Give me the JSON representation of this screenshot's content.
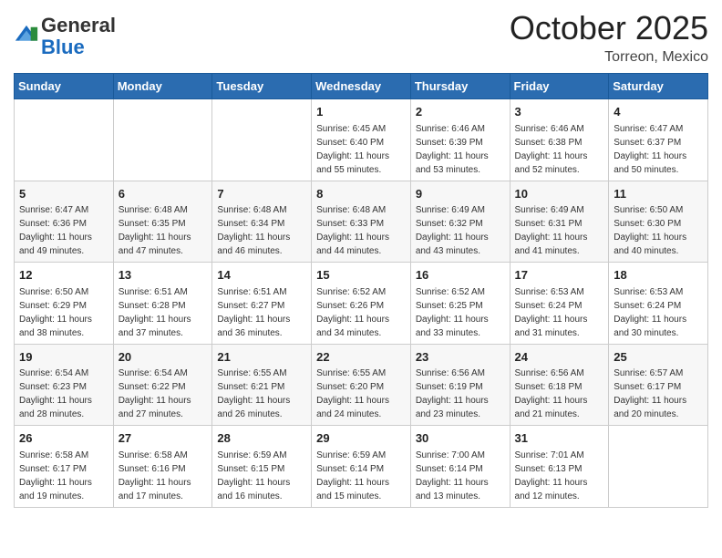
{
  "header": {
    "logo_general": "General",
    "logo_blue": "Blue",
    "month_title": "October 2025",
    "location": "Torreon, Mexico"
  },
  "days_of_week": [
    "Sunday",
    "Monday",
    "Tuesday",
    "Wednesday",
    "Thursday",
    "Friday",
    "Saturday"
  ],
  "weeks": [
    [
      {
        "day": "",
        "info": ""
      },
      {
        "day": "",
        "info": ""
      },
      {
        "day": "",
        "info": ""
      },
      {
        "day": "1",
        "info": "Sunrise: 6:45 AM\nSunset: 6:40 PM\nDaylight: 11 hours\nand 55 minutes."
      },
      {
        "day": "2",
        "info": "Sunrise: 6:46 AM\nSunset: 6:39 PM\nDaylight: 11 hours\nand 53 minutes."
      },
      {
        "day": "3",
        "info": "Sunrise: 6:46 AM\nSunset: 6:38 PM\nDaylight: 11 hours\nand 52 minutes."
      },
      {
        "day": "4",
        "info": "Sunrise: 6:47 AM\nSunset: 6:37 PM\nDaylight: 11 hours\nand 50 minutes."
      }
    ],
    [
      {
        "day": "5",
        "info": "Sunrise: 6:47 AM\nSunset: 6:36 PM\nDaylight: 11 hours\nand 49 minutes."
      },
      {
        "day": "6",
        "info": "Sunrise: 6:48 AM\nSunset: 6:35 PM\nDaylight: 11 hours\nand 47 minutes."
      },
      {
        "day": "7",
        "info": "Sunrise: 6:48 AM\nSunset: 6:34 PM\nDaylight: 11 hours\nand 46 minutes."
      },
      {
        "day": "8",
        "info": "Sunrise: 6:48 AM\nSunset: 6:33 PM\nDaylight: 11 hours\nand 44 minutes."
      },
      {
        "day": "9",
        "info": "Sunrise: 6:49 AM\nSunset: 6:32 PM\nDaylight: 11 hours\nand 43 minutes."
      },
      {
        "day": "10",
        "info": "Sunrise: 6:49 AM\nSunset: 6:31 PM\nDaylight: 11 hours\nand 41 minutes."
      },
      {
        "day": "11",
        "info": "Sunrise: 6:50 AM\nSunset: 6:30 PM\nDaylight: 11 hours\nand 40 minutes."
      }
    ],
    [
      {
        "day": "12",
        "info": "Sunrise: 6:50 AM\nSunset: 6:29 PM\nDaylight: 11 hours\nand 38 minutes."
      },
      {
        "day": "13",
        "info": "Sunrise: 6:51 AM\nSunset: 6:28 PM\nDaylight: 11 hours\nand 37 minutes."
      },
      {
        "day": "14",
        "info": "Sunrise: 6:51 AM\nSunset: 6:27 PM\nDaylight: 11 hours\nand 36 minutes."
      },
      {
        "day": "15",
        "info": "Sunrise: 6:52 AM\nSunset: 6:26 PM\nDaylight: 11 hours\nand 34 minutes."
      },
      {
        "day": "16",
        "info": "Sunrise: 6:52 AM\nSunset: 6:25 PM\nDaylight: 11 hours\nand 33 minutes."
      },
      {
        "day": "17",
        "info": "Sunrise: 6:53 AM\nSunset: 6:24 PM\nDaylight: 11 hours\nand 31 minutes."
      },
      {
        "day": "18",
        "info": "Sunrise: 6:53 AM\nSunset: 6:24 PM\nDaylight: 11 hours\nand 30 minutes."
      }
    ],
    [
      {
        "day": "19",
        "info": "Sunrise: 6:54 AM\nSunset: 6:23 PM\nDaylight: 11 hours\nand 28 minutes."
      },
      {
        "day": "20",
        "info": "Sunrise: 6:54 AM\nSunset: 6:22 PM\nDaylight: 11 hours\nand 27 minutes."
      },
      {
        "day": "21",
        "info": "Sunrise: 6:55 AM\nSunset: 6:21 PM\nDaylight: 11 hours\nand 26 minutes."
      },
      {
        "day": "22",
        "info": "Sunrise: 6:55 AM\nSunset: 6:20 PM\nDaylight: 11 hours\nand 24 minutes."
      },
      {
        "day": "23",
        "info": "Sunrise: 6:56 AM\nSunset: 6:19 PM\nDaylight: 11 hours\nand 23 minutes."
      },
      {
        "day": "24",
        "info": "Sunrise: 6:56 AM\nSunset: 6:18 PM\nDaylight: 11 hours\nand 21 minutes."
      },
      {
        "day": "25",
        "info": "Sunrise: 6:57 AM\nSunset: 6:17 PM\nDaylight: 11 hours\nand 20 minutes."
      }
    ],
    [
      {
        "day": "26",
        "info": "Sunrise: 6:58 AM\nSunset: 6:17 PM\nDaylight: 11 hours\nand 19 minutes."
      },
      {
        "day": "27",
        "info": "Sunrise: 6:58 AM\nSunset: 6:16 PM\nDaylight: 11 hours\nand 17 minutes."
      },
      {
        "day": "28",
        "info": "Sunrise: 6:59 AM\nSunset: 6:15 PM\nDaylight: 11 hours\nand 16 minutes."
      },
      {
        "day": "29",
        "info": "Sunrise: 6:59 AM\nSunset: 6:14 PM\nDaylight: 11 hours\nand 15 minutes."
      },
      {
        "day": "30",
        "info": "Sunrise: 7:00 AM\nSunset: 6:14 PM\nDaylight: 11 hours\nand 13 minutes."
      },
      {
        "day": "31",
        "info": "Sunrise: 7:01 AM\nSunset: 6:13 PM\nDaylight: 11 hours\nand 12 minutes."
      },
      {
        "day": "",
        "info": ""
      }
    ]
  ]
}
